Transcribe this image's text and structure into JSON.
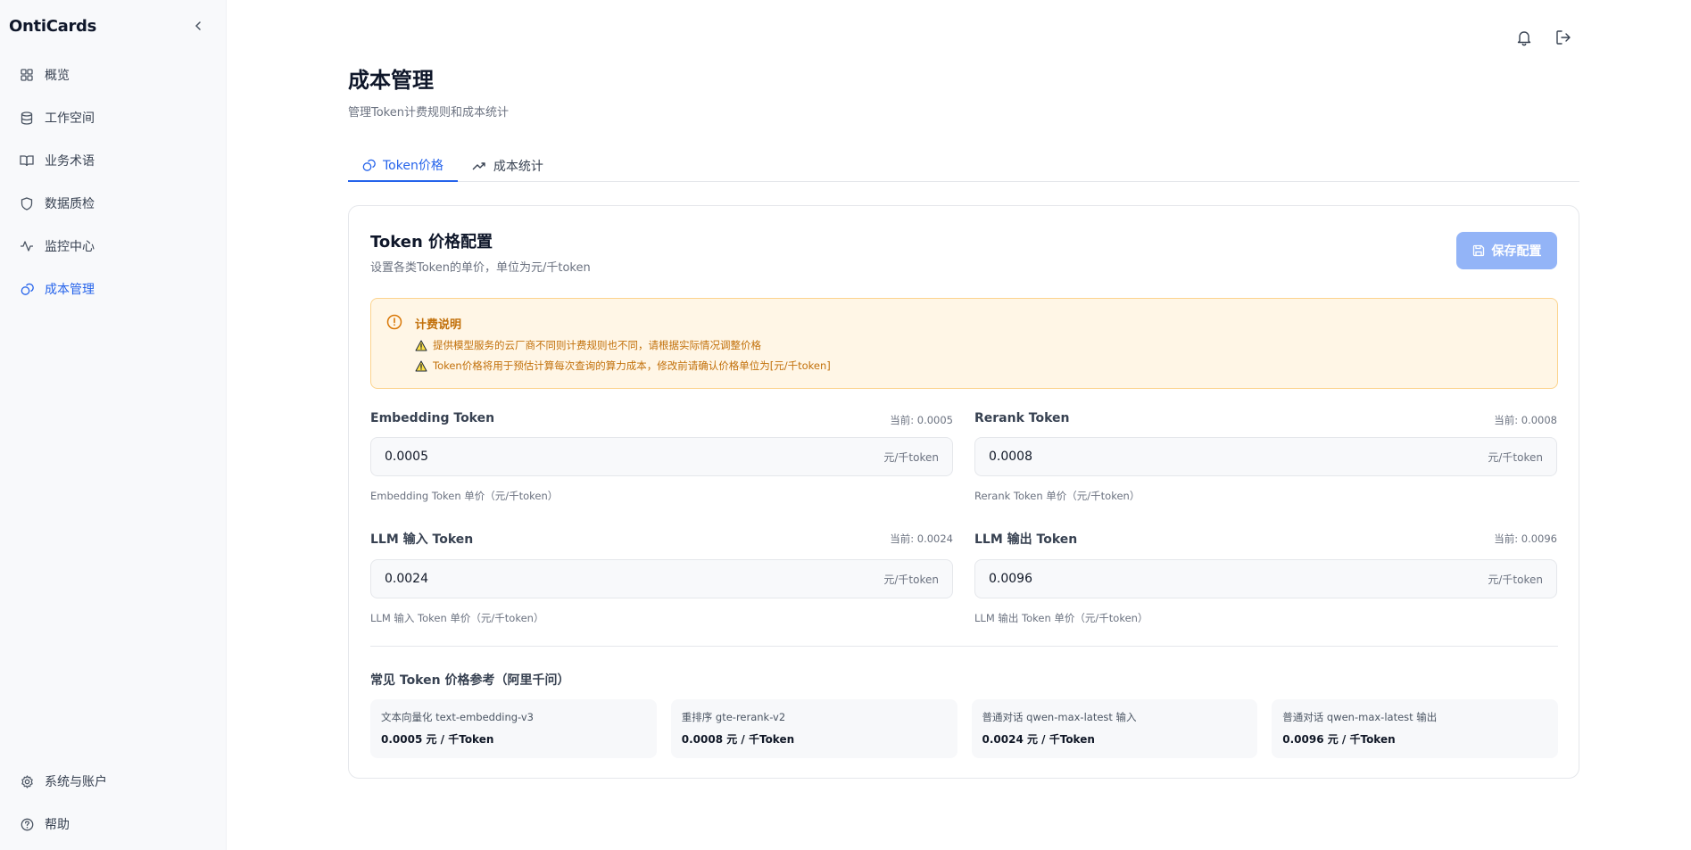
{
  "app": {
    "brand": "OntiCards"
  },
  "sidebar": {
    "items": [
      {
        "label": "概览",
        "icon": "grid-icon"
      },
      {
        "label": "工作空间",
        "icon": "database-icon"
      },
      {
        "label": "业务术语",
        "icon": "book-icon"
      },
      {
        "label": "数据质检",
        "icon": "shield-icon"
      },
      {
        "label": "监控中心",
        "icon": "activity-icon"
      },
      {
        "label": "成本管理",
        "icon": "coins-icon",
        "active": true
      }
    ],
    "bottom": [
      {
        "label": "系统与账户",
        "icon": "gear-icon"
      },
      {
        "label": "帮助",
        "icon": "help-circle-icon"
      }
    ]
  },
  "header": {
    "icons": [
      "bell-icon",
      "logout-icon"
    ]
  },
  "page": {
    "title": "成本管理",
    "subtitle": "管理Token计费规则和成本统计"
  },
  "tabs": [
    {
      "label": "Token价格",
      "icon": "coins-icon",
      "active": true
    },
    {
      "label": "成本统计",
      "icon": "trending-up-icon",
      "active": false
    }
  ],
  "card": {
    "title": "Token 价格配置",
    "subtitle": "设置各类Token的单价，单位为元/千token",
    "save_label": "保存配置"
  },
  "notice": {
    "title": "计费说明",
    "lines": [
      "提供模型服务的云厂商不同则计费规则也不同，请根据实际情况调整价格",
      "Token价格将用于预估计算每次查询的算力成本，修改前请确认价格单位为[元/千token]"
    ]
  },
  "fields": [
    {
      "label": "Embedding Token",
      "current": "当前: 0.0005",
      "value": "0.0005",
      "unit": "元/千token",
      "help": "Embedding Token 单价（元/千token）"
    },
    {
      "label": "Rerank Token",
      "current": "当前: 0.0008",
      "value": "0.0008",
      "unit": "元/千token",
      "help": "Rerank Token 单价（元/千token）"
    },
    {
      "label": "LLM 输入 Token",
      "current": "当前: 0.0024",
      "value": "0.0024",
      "unit": "元/千token",
      "help": "LLM 输入 Token 单价（元/千token）"
    },
    {
      "label": "LLM 输出 Token",
      "current": "当前: 0.0096",
      "value": "0.0096",
      "unit": "元/千token",
      "help": "LLM 输出 Token 单价（元/千token）"
    }
  ],
  "reference": {
    "title": "常见 Token 价格参考（阿里千问）",
    "items": [
      {
        "name": "文本向量化 text-embedding-v3",
        "price": "0.0005 元 / 千Token"
      },
      {
        "name": "重排序 gte-rerank-v2",
        "price": "0.0008 元 / 千Token"
      },
      {
        "name": "普通对话 qwen-max-latest 输入",
        "price": "0.0024 元 / 千Token"
      },
      {
        "name": "普通对话 qwen-max-latest 输出",
        "price": "0.0096 元 / 千Token"
      }
    ]
  },
  "colors": {
    "accent": "#2563eb",
    "warning": "#c2700a",
    "warning_bg": "#fff6e6"
  }
}
